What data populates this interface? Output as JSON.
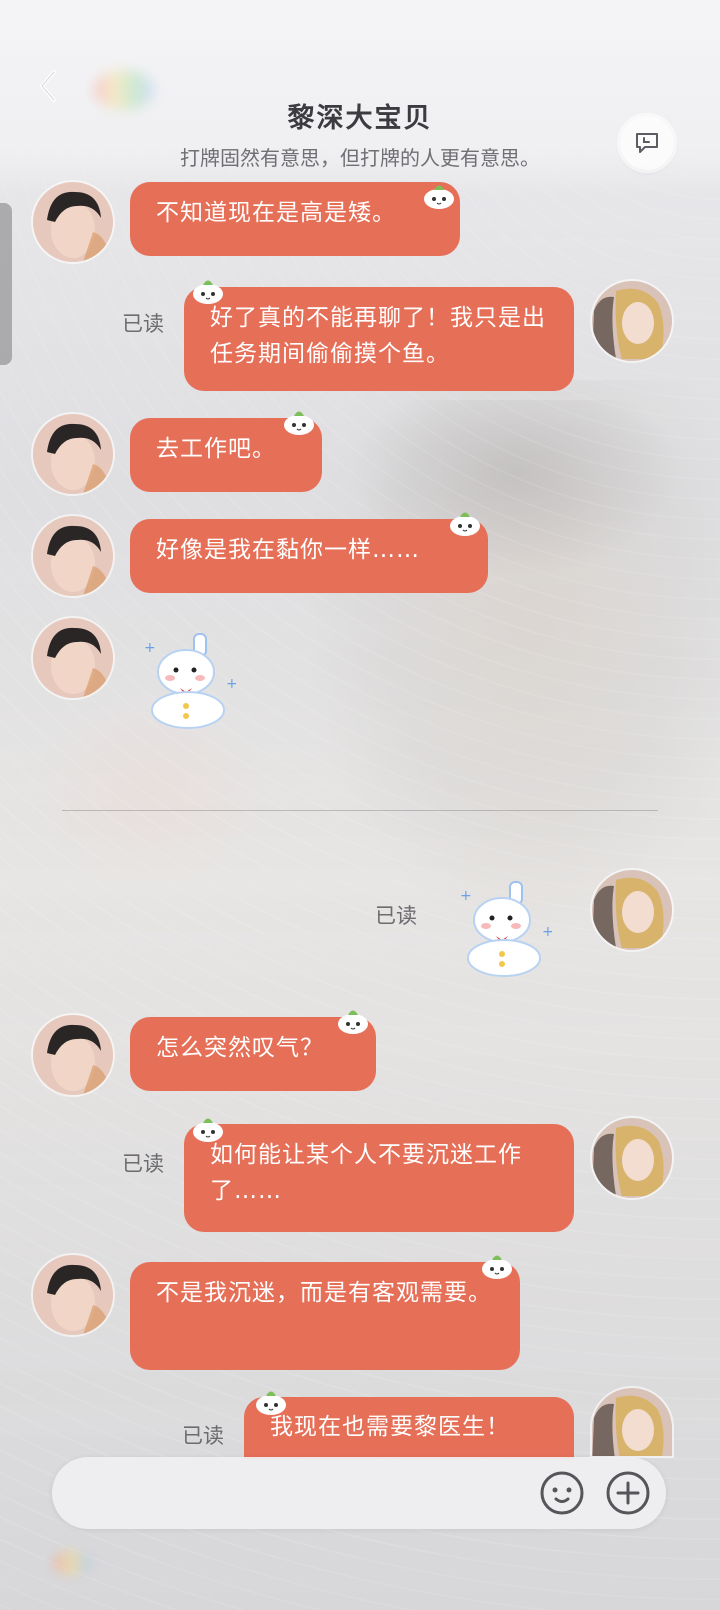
{
  "header": {
    "title": "黎深大宝贝",
    "subtitle": "打牌固然有意思，但打牌的人更有意思。",
    "back_icon": "chevron-left-icon",
    "action_icon": "chat-bubble-icon"
  },
  "colors": {
    "bubble": "#e66f58",
    "bubble_text": "#ffffff",
    "read_text": "#6c6c70"
  },
  "messages": [
    {
      "side": "left",
      "text": "不知道现在是高是矮。"
    },
    {
      "side": "right",
      "status": "已读",
      "text": "好了真的不能再聊了！我只是出任务期间偷偷摸个鱼。"
    },
    {
      "side": "left",
      "text": "去工作吧。"
    },
    {
      "side": "left",
      "text": "好像是我在黏你一样……"
    },
    {
      "side": "left",
      "sticker": "snowman-sticker"
    },
    {
      "side": "right",
      "status": "已读",
      "sticker": "snowman-sticker"
    },
    {
      "side": "left",
      "text": "怎么突然叹气？"
    },
    {
      "side": "right",
      "status": "已读",
      "text": "如何能让某个人不要沉迷工作了……"
    },
    {
      "side": "left",
      "text": "不是我沉迷，而是有客观需要。"
    },
    {
      "side": "right",
      "status": "已读",
      "text": "我现在也需要黎医生！"
    }
  ],
  "composer": {
    "value": "",
    "placeholder": "",
    "emoji_icon": "smiley-face-icon",
    "plus_icon": "plus-circle-icon"
  }
}
